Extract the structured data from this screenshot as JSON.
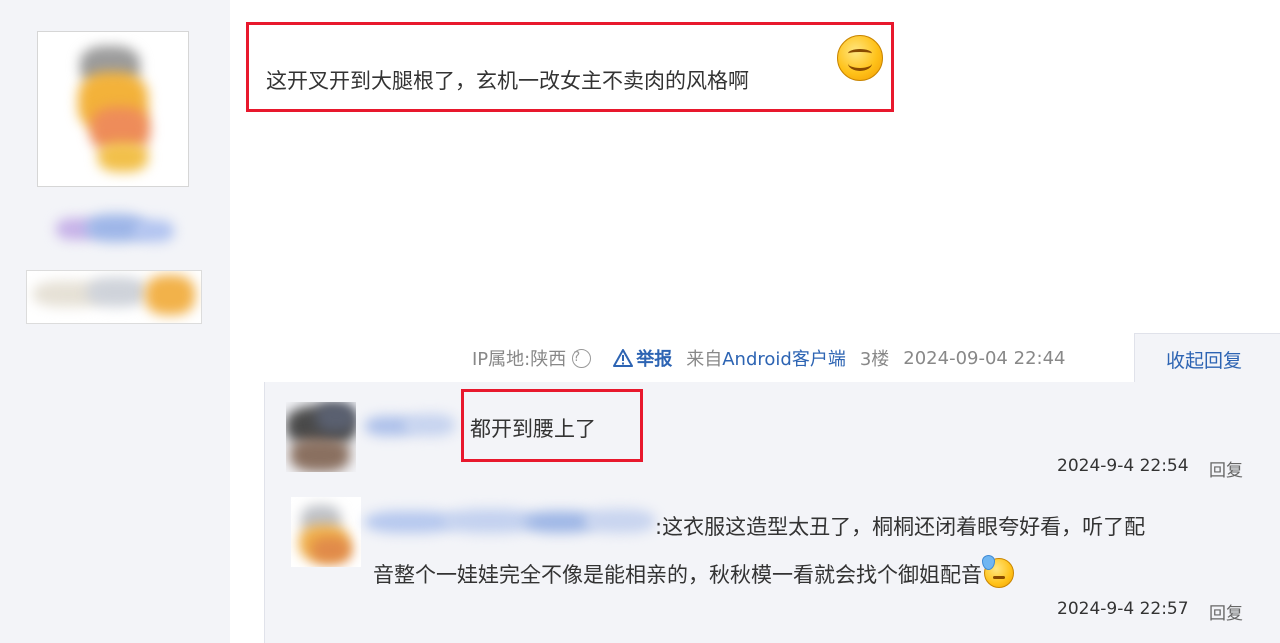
{
  "post": {
    "text": "这开叉开到大腿根了，玄机一改女主不卖肉的风格啊",
    "emoji": "smile-emoji"
  },
  "meta": {
    "ip_location": "IP属地:陕西",
    "help_icon_glyph": "?",
    "report_label": "举报",
    "from_prefix": "来自",
    "client": "Android客户端",
    "floor": "3楼",
    "time": "2024-09-04 22:44"
  },
  "reply_panel": {
    "collapse_label": "收起回复",
    "replies": [
      {
        "text": "都开到腰上了",
        "time": "2024-9-4 22:54",
        "reply_label": "回复"
      },
      {
        "text_line1": ":这衣服这造型太丑了，桐桐还闭着眼夸好看，听了配",
        "text_line2": "音整个一娃娃完全不像是能相亲的，秋秋模一看就会找个御姐配音",
        "emoji": "sweat-emoji",
        "time": "2024-9-4 22:57",
        "reply_label": "回复"
      }
    ]
  },
  "colors": {
    "highlight_box": "#e8182d",
    "link": "#2d64b3",
    "panel_bg": "#f3f4f8"
  }
}
